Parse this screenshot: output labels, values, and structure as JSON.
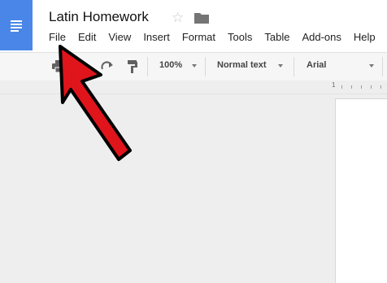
{
  "document": {
    "title": "Latin Homework"
  },
  "menu": {
    "items": [
      {
        "label": "File"
      },
      {
        "label": "Edit"
      },
      {
        "label": "View"
      },
      {
        "label": "Insert"
      },
      {
        "label": "Format"
      },
      {
        "label": "Tools"
      },
      {
        "label": "Table"
      },
      {
        "label": "Add-ons"
      },
      {
        "label": "Help"
      }
    ]
  },
  "toolbar": {
    "zoom": "100%",
    "style": "Normal text",
    "font": "Arial"
  },
  "ruler": {
    "marker": "1"
  },
  "colors": {
    "brand": "#4a86e8",
    "arrow": "#e0141b",
    "background": "#eeeeee"
  },
  "icons": [
    "docs-logo-icon",
    "star-icon",
    "folder-icon",
    "print-icon",
    "redo-icon",
    "paint-format-icon"
  ]
}
